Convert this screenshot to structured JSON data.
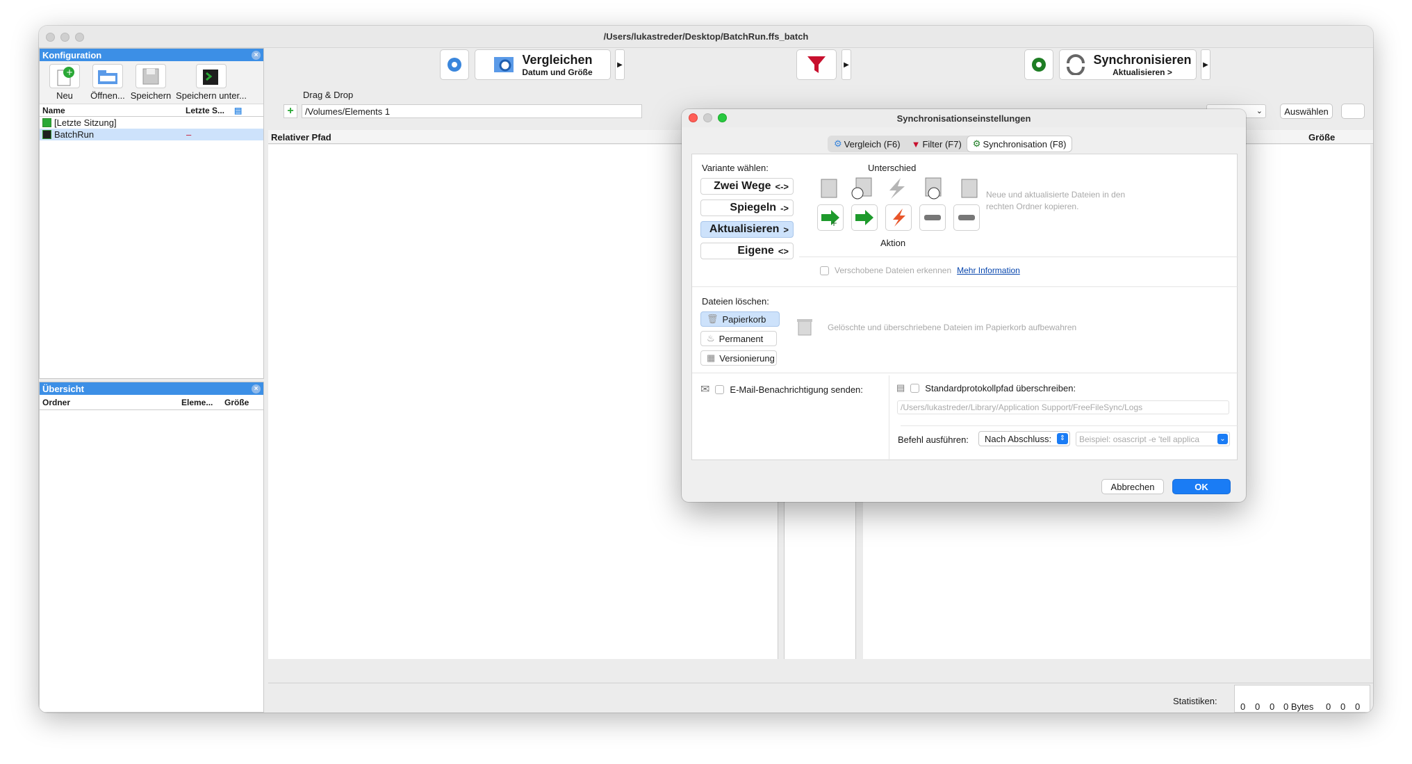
{
  "window": {
    "title": "/Users/lukastreder/Desktop/BatchRun.ffs_batch"
  },
  "config_panel": {
    "title": "Konfiguration",
    "toolbar": [
      {
        "label": "Neu",
        "icon": "new-config-icon"
      },
      {
        "label": "Öffnen...",
        "icon": "open-config-icon"
      },
      {
        "label": "Speichern",
        "icon": "save-icon"
      },
      {
        "label": "Speichern unter...",
        "icon": "save-as-batch-icon"
      }
    ],
    "columns": {
      "name": "Name",
      "last": "Letzte S..."
    },
    "items": [
      {
        "label": "[Letzte Sitzung]",
        "mark": ""
      },
      {
        "label": "BatchRun",
        "mark": "–"
      }
    ]
  },
  "overview_panel": {
    "title": "Übersicht",
    "columns": {
      "folder": "Ordner",
      "items": "Eleme...",
      "size": "Größe"
    }
  },
  "main_toolbar": {
    "compare_label": "Vergleichen",
    "compare_sub": "Datum und Größe",
    "sync_label": "Synchronisieren",
    "sync_sub": "Aktualisieren >"
  },
  "folder_bar": {
    "drag_drop": "Drag & Drop",
    "left_path": "/Volumes/Elements 1",
    "select_label": "Auswählen"
  },
  "grid": {
    "rel_path": "Relativer Pfad",
    "size": "Größe"
  },
  "stats": {
    "label": "Statistiken:",
    "values": [
      "0",
      "0",
      "0",
      "0 Bytes",
      "0",
      "0",
      "0"
    ]
  },
  "dialog": {
    "title": "Synchronisationseinstellungen",
    "tabs": [
      {
        "label": "Vergleich (F6)",
        "active": false
      },
      {
        "label": "Filter (F7)",
        "active": false
      },
      {
        "label": "Synchronisation (F8)",
        "active": true
      }
    ],
    "variant_label": "Variante wählen:",
    "variants": [
      {
        "label": "Zwei Wege",
        "symbol": "<->",
        "selected": false
      },
      {
        "label": "Spiegeln",
        "symbol": "->",
        "selected": false
      },
      {
        "label": "Aktualisieren",
        "symbol": ">",
        "selected": true
      },
      {
        "label": "Eigene",
        "symbol": "<>",
        "selected": false
      }
    ],
    "difference_label": "Unterschied",
    "action_label": "Aktion",
    "description": "Neue und aktualisierte Dateien in den rechten Ordner kopieren.",
    "detect_moved": "Verschobene Dateien erkennen",
    "more_info": "Mehr Information",
    "delete_label": "Dateien löschen:",
    "delete_options": [
      {
        "label": "Papierkorb",
        "selected": true
      },
      {
        "label": "Permanent",
        "selected": false
      },
      {
        "label": "Versionierung",
        "selected": false
      }
    ],
    "delete_description": "Gelöschte und überschriebene Dateien im Papierkorb aufbewahren",
    "email_label": "E-Mail-Benachrichtigung senden:",
    "log_label": "Standardprotokollpfad überschreiben:",
    "log_path": "/Users/lukastreder/Library/Application Support/FreeFileSync/Logs",
    "run_cmd_label": "Befehl ausführen:",
    "run_when": "Nach Abschluss:",
    "cmd_placeholder": "Beispiel: osascript -e 'tell applica",
    "cancel": "Abbrechen",
    "ok": "OK"
  },
  "colors": {
    "accent": "#3c8fe6",
    "selection": "#cde2fb",
    "ok": "#1a7cf5",
    "green": "#1e9a2c",
    "red": "#c8102e"
  }
}
